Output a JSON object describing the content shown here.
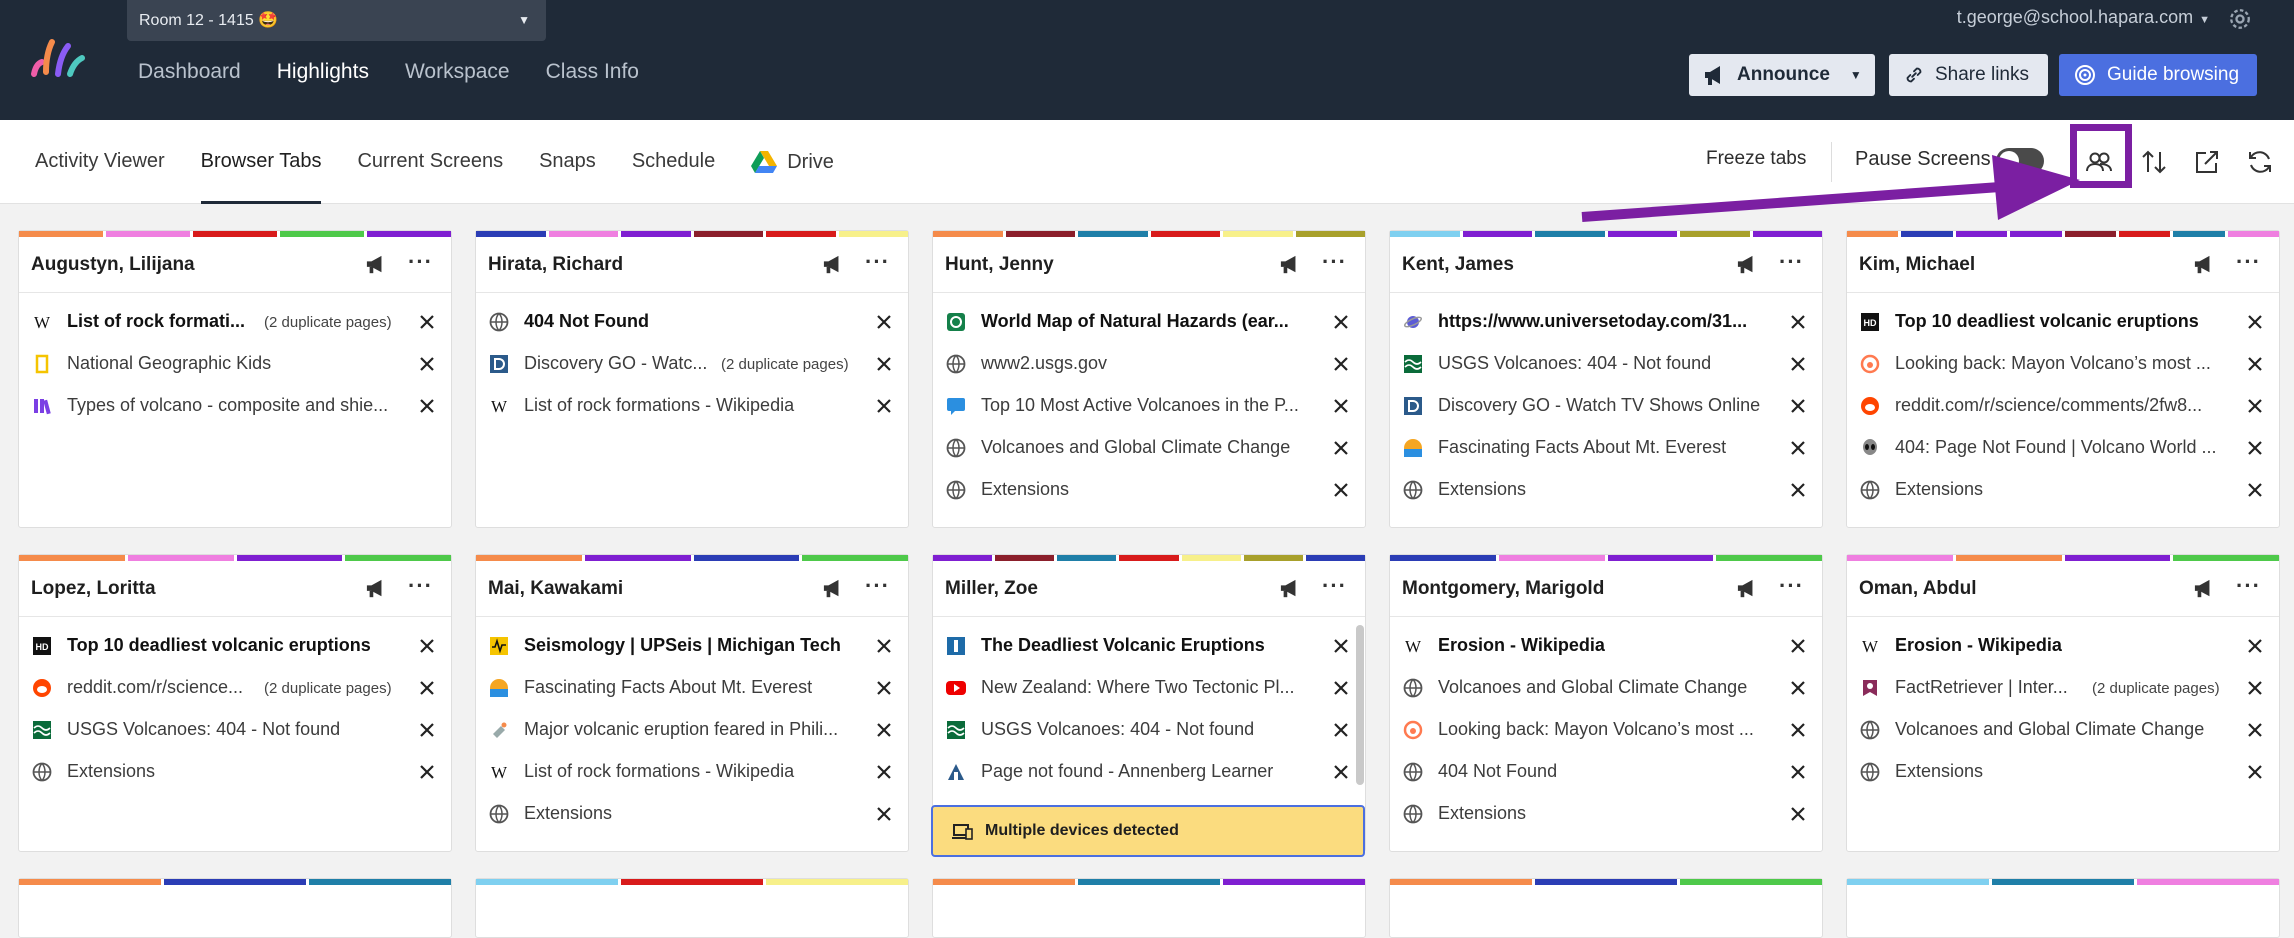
{
  "header": {
    "room": "Room 12 - 1415 🤩",
    "nav": [
      "Dashboard",
      "Highlights",
      "Workspace",
      "Class Info"
    ],
    "active_nav": 1,
    "user": "t.george@school.hapara.com",
    "announce": "Announce",
    "share": "Share links",
    "guide": "Guide browsing"
  },
  "subnav": {
    "tabs": [
      "Activity Viewer",
      "Browser Tabs",
      "Current Screens",
      "Snaps",
      "Schedule",
      "Drive"
    ],
    "active_tab": 1,
    "freeze": "Freeze tabs",
    "pause": "Pause Screens",
    "pause_on": false
  },
  "colors": {
    "red": "#d81b1b",
    "violet": "#7f1fd1",
    "pink": "#ef7fe0",
    "green": "#4ec94a",
    "orange": "#f58b4b",
    "navy": "#2b3db5",
    "maroon": "#8b1f2b",
    "yellow": "#f7f08a",
    "teal": "#1f7fa8",
    "olive": "#a8a02b",
    "sky": "#7fd0f0",
    "highlight": "#7b1fa2"
  },
  "dup_label": "(2 duplicate pages)",
  "multi_label": "Multiple devices detected",
  "cards": [
    {
      "name": "Augustyn, Lilijana",
      "colors": [
        "orange",
        "pink",
        "red",
        "green",
        "violet"
      ],
      "tabs": [
        {
          "icon": "wikipedia-icon",
          "title": "List of rock formati...",
          "bold": true,
          "dup": true
        },
        {
          "icon": "natgeo-kids-icon",
          "title": "National Geographic Kids"
        },
        {
          "icon": "library-icon",
          "title": "Types of volcano - composite and shie..."
        }
      ]
    },
    {
      "name": "Hirata, Richard",
      "colors": [
        "navy",
        "pink",
        "violet",
        "maroon",
        "red",
        "yellow"
      ],
      "tabs": [
        {
          "icon": "globe-icon",
          "title": "404 Not Found",
          "bold": true
        },
        {
          "icon": "discovery-icon",
          "title": "Discovery GO - Watc...",
          "dup": true
        },
        {
          "icon": "wikipedia-icon",
          "title": "List of rock formations - Wikipedia"
        }
      ]
    },
    {
      "name": "Hunt, Jenny",
      "colors": [
        "orange",
        "maroon",
        "teal",
        "red",
        "yellow",
        "olive"
      ],
      "tabs": [
        {
          "icon": "map-icon",
          "title": "World Map of Natural Hazards (ear...",
          "bold": true
        },
        {
          "icon": "globe-icon",
          "title": "www2.usgs.gov"
        },
        {
          "icon": "chat-icon",
          "title": "Top 10 Most Active Volcanoes in the P..."
        },
        {
          "icon": "globe-icon",
          "title": "Volcanoes and Global Climate Change"
        },
        {
          "icon": "globe-icon",
          "title": "Extensions"
        }
      ]
    },
    {
      "name": "Kent, James",
      "colors": [
        "sky",
        "violet",
        "teal",
        "violet",
        "olive",
        "violet"
      ],
      "tabs": [
        {
          "icon": "planet-icon",
          "title": "https://www.universetoday.com/31...",
          "bold": true
        },
        {
          "icon": "usgs-icon",
          "title": "USGS Volcanoes: 404 - Not found"
        },
        {
          "icon": "discovery-icon",
          "title": "Discovery GO - Watch TV Shows Online"
        },
        {
          "icon": "sunset-icon",
          "title": "Fascinating Facts About Mt. Everest"
        },
        {
          "icon": "globe-icon",
          "title": "Extensions"
        }
      ]
    },
    {
      "name": "Kim, Michael",
      "colors": [
        "orange",
        "navy",
        "violet",
        "violet",
        "maroon",
        "red",
        "teal",
        "pink"
      ],
      "tabs": [
        {
          "icon": "hd-icon",
          "title": "Top 10 deadliest volcanic eruptions",
          "bold": true
        },
        {
          "icon": "reddit-outline-icon",
          "title": "Looking back: Mayon Volcano’s most ..."
        },
        {
          "icon": "reddit-icon",
          "title": "reddit.com/r/science/comments/2fw8..."
        },
        {
          "icon": "alien-icon",
          "title": "404: Page Not Found | Volcano World ..."
        },
        {
          "icon": "globe-icon",
          "title": "Extensions"
        }
      ]
    },
    {
      "name": "Lopez, Loritta",
      "colors": [
        "orange",
        "pink",
        "violet",
        "green"
      ],
      "tabs": [
        {
          "icon": "hd-icon",
          "title": "Top 10 deadliest volcanic eruptions",
          "bold": true
        },
        {
          "icon": "reddit-icon",
          "title": "reddit.com/r/science...",
          "dup": true
        },
        {
          "icon": "usgs-icon",
          "title": "USGS Volcanoes: 404 - Not found"
        },
        {
          "icon": "globe-icon",
          "title": "Extensions"
        }
      ]
    },
    {
      "name": "Mai, Kawakami",
      "colors": [
        "orange",
        "violet",
        "navy",
        "green"
      ],
      "tabs": [
        {
          "icon": "seismo-icon",
          "title": "Seismology | UPSeis | Michigan Tech",
          "bold": true
        },
        {
          "icon": "sunset-icon",
          "title": "Fascinating Facts About Mt. Everest"
        },
        {
          "icon": "satellite-icon",
          "title": "Major volcanic eruption feared in Phili..."
        },
        {
          "icon": "wikipedia-icon",
          "title": "List of rock formations - Wikipedia"
        },
        {
          "icon": "globe-icon",
          "title": "Extensions"
        }
      ]
    },
    {
      "name": "Miller, Zoe",
      "colors": [
        "violet",
        "maroon",
        "teal",
        "red",
        "yellow",
        "olive",
        "navy"
      ],
      "multi": true,
      "tabs": [
        {
          "icon": "britannica-icon",
          "title": "The Deadliest Volcanic Eruptions",
          "bold": true
        },
        {
          "icon": "youtube-icon",
          "title": "New Zealand: Where Two Tectonic Pl..."
        },
        {
          "icon": "usgs-icon",
          "title": "USGS Volcanoes: 404 - Not found"
        },
        {
          "icon": "annenberg-icon",
          "title": "Page not found - Annenberg Learner"
        }
      ]
    },
    {
      "name": "Montgomery, Marigold",
      "colors": [
        "navy",
        "pink",
        "violet",
        "green"
      ],
      "tabs": [
        {
          "icon": "wikipedia-icon",
          "title": "Erosion - Wikipedia",
          "bold": true
        },
        {
          "icon": "globe-icon",
          "title": "Volcanoes and Global Climate Change"
        },
        {
          "icon": "reddit-outline-icon",
          "title": "Looking back: Mayon Volcano’s most ..."
        },
        {
          "icon": "globe-icon",
          "title": "404 Not Found"
        },
        {
          "icon": "globe-icon",
          "title": "Extensions"
        }
      ]
    },
    {
      "name": "Oman, Abdul",
      "colors": [
        "pink",
        "orange",
        "violet",
        "green"
      ],
      "tabs": [
        {
          "icon": "wikipedia-icon",
          "title": "Erosion - Wikipedia",
          "bold": true
        },
        {
          "icon": "factretriever-icon",
          "title": "FactRetriever | Inter...",
          "dup": true
        },
        {
          "icon": "globe-icon",
          "title": "Volcanoes and Global Climate Change"
        },
        {
          "icon": "globe-icon",
          "title": "Extensions"
        }
      ]
    }
  ],
  "third_row_colors": [
    [
      "orange",
      "navy",
      "teal"
    ],
    [
      "sky",
      "red",
      "yellow"
    ],
    [
      "orange",
      "teal",
      "violet"
    ],
    [
      "orange",
      "navy",
      "green"
    ],
    [
      "sky",
      "teal",
      "pink"
    ]
  ]
}
